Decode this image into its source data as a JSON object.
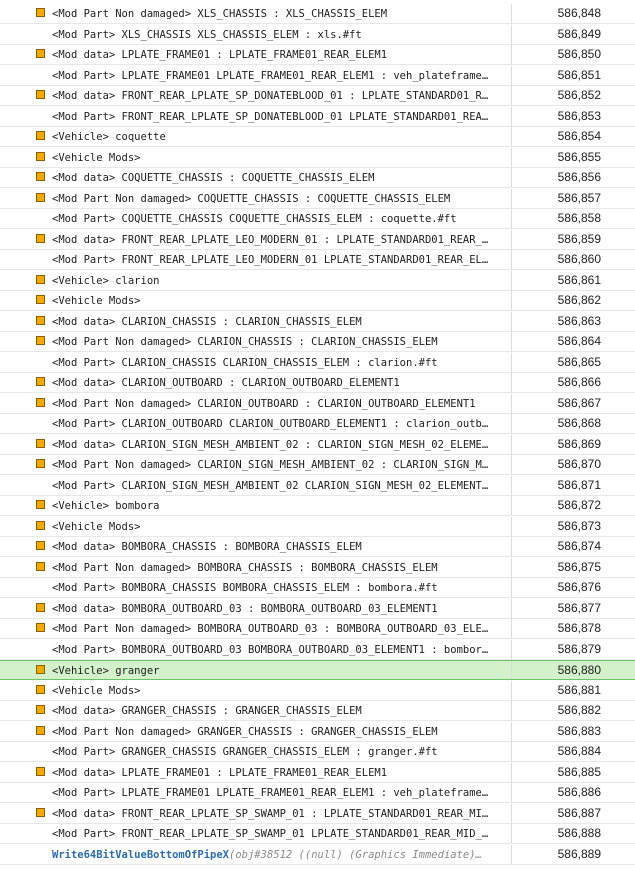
{
  "colors": {
    "marker": "#f2a900",
    "highlight_row": "#d3f2cc",
    "function_text": "#2b6cb0"
  },
  "rows": [
    {
      "marker": true,
      "label": "<Mod Part Non damaged> XLS_CHASSIS : XLS_CHASSIS_ELEM",
      "id": "586,848"
    },
    {
      "marker": false,
      "label": "<Mod Part> XLS_CHASSIS XLS_CHASSIS_ELEM : xls.#ft",
      "id": "586,849"
    },
    {
      "marker": true,
      "label": "<Mod data> LPLATE_FRAME01 : LPLATE_FRAME01_REAR_ELEM1",
      "id": "586,850"
    },
    {
      "marker": false,
      "label": "<Mod Part> LPLATE_FRAME01 LPLATE_FRAME01_REAR_ELEM1 : veh_plateframe…",
      "id": "586,851"
    },
    {
      "marker": true,
      "label": "<Mod data> FRONT_REAR_LPLATE_SP_DONATEBLOOD_01 : LPLATE_STANDARD01_R…",
      "id": "586,852"
    },
    {
      "marker": false,
      "label": "<Mod Part> FRONT_REAR_LPLATE_SP_DONATEBLOOD_01 LPLATE_STANDARD01_REA…",
      "id": "586,853"
    },
    {
      "marker": true,
      "label": "<Vehicle> coquette",
      "id": "586,854"
    },
    {
      "marker": true,
      "label": "<Vehicle Mods>",
      "id": "586,855"
    },
    {
      "marker": true,
      "label": "<Mod data> COQUETTE_CHASSIS : COQUETTE_CHASSIS_ELEM",
      "id": "586,856"
    },
    {
      "marker": true,
      "label": "<Mod Part Non damaged> COQUETTE_CHASSIS : COQUETTE_CHASSIS_ELEM",
      "id": "586,857"
    },
    {
      "marker": false,
      "label": "<Mod Part> COQUETTE_CHASSIS COQUETTE_CHASSIS_ELEM : coquette.#ft",
      "id": "586,858"
    },
    {
      "marker": true,
      "label": "<Mod data> FRONT_REAR_LPLATE_LEO_MODERN_01 : LPLATE_STANDARD01_REAR_…",
      "id": "586,859"
    },
    {
      "marker": false,
      "label": "<Mod Part> FRONT_REAR_LPLATE_LEO_MODERN_01 LPLATE_STANDARD01_REAR_EL…",
      "id": "586,860"
    },
    {
      "marker": true,
      "label": "<Vehicle> clarion",
      "id": "586,861"
    },
    {
      "marker": true,
      "label": "<Vehicle Mods>",
      "id": "586,862"
    },
    {
      "marker": true,
      "label": "<Mod data> CLARION_CHASSIS : CLARION_CHASSIS_ELEM",
      "id": "586,863"
    },
    {
      "marker": true,
      "label": "<Mod Part Non damaged> CLARION_CHASSIS : CLARION_CHASSIS_ELEM",
      "id": "586,864"
    },
    {
      "marker": false,
      "label": "<Mod Part> CLARION_CHASSIS CLARION_CHASSIS_ELEM : clarion.#ft",
      "id": "586,865"
    },
    {
      "marker": true,
      "label": "<Mod data> CLARION_OUTBOARD : CLARION_OUTBOARD_ELEMENT1",
      "id": "586,866"
    },
    {
      "marker": true,
      "label": "<Mod Part Non damaged> CLARION_OUTBOARD : CLARION_OUTBOARD_ELEMENT1",
      "id": "586,867"
    },
    {
      "marker": false,
      "label": "<Mod Part> CLARION_OUTBOARD CLARION_OUTBOARD_ELEMENT1 : clarion_outb…",
      "id": "586,868"
    },
    {
      "marker": true,
      "label": "<Mod data> CLARION_SIGN_MESH_AMBIENT_02 : CLARION_SIGN_MESH_02_ELEME…",
      "id": "586,869"
    },
    {
      "marker": true,
      "label": "<Mod Part Non damaged> CLARION_SIGN_MESH_AMBIENT_02 : CLARION_SIGN_M…",
      "id": "586,870"
    },
    {
      "marker": false,
      "label": "<Mod Part> CLARION_SIGN_MESH_AMBIENT_02 CLARION_SIGN_MESH_02_ELEMENT…",
      "id": "586,871"
    },
    {
      "marker": true,
      "label": "<Vehicle> bombora",
      "id": "586,872"
    },
    {
      "marker": true,
      "label": "<Vehicle Mods>",
      "id": "586,873"
    },
    {
      "marker": true,
      "label": "<Mod data> BOMBORA_CHASSIS : BOMBORA_CHASSIS_ELEM",
      "id": "586,874"
    },
    {
      "marker": true,
      "label": "<Mod Part Non damaged> BOMBORA_CHASSIS : BOMBORA_CHASSIS_ELEM",
      "id": "586,875"
    },
    {
      "marker": false,
      "label": "<Mod Part> BOMBORA_CHASSIS BOMBORA_CHASSIS_ELEM : bombora.#ft",
      "id": "586,876"
    },
    {
      "marker": true,
      "label": "<Mod data> BOMBORA_OUTBOARD_03 : BOMBORA_OUTBOARD_03_ELEMENT1",
      "id": "586,877"
    },
    {
      "marker": true,
      "label": "<Mod Part Non damaged> BOMBORA_OUTBOARD_03 : BOMBORA_OUTBOARD_03_ELE…",
      "id": "586,878"
    },
    {
      "marker": false,
      "label": "<Mod Part> BOMBORA_OUTBOARD_03 BOMBORA_OUTBOARD_03_ELEMENT1 : bombor…",
      "id": "586,879"
    },
    {
      "marker": true,
      "label": "<Vehicle> granger",
      "id": "586,880",
      "highlight": true
    },
    {
      "marker": true,
      "label": "<Vehicle Mods>",
      "id": "586,881"
    },
    {
      "marker": true,
      "label": "<Mod data> GRANGER_CHASSIS : GRANGER_CHASSIS_ELEM",
      "id": "586,882"
    },
    {
      "marker": true,
      "label": "<Mod Part Non damaged> GRANGER_CHASSIS : GRANGER_CHASSIS_ELEM",
      "id": "586,883"
    },
    {
      "marker": false,
      "label": "<Mod Part> GRANGER_CHASSIS GRANGER_CHASSIS_ELEM : granger.#ft",
      "id": "586,884"
    },
    {
      "marker": true,
      "label": "<Mod data> LPLATE_FRAME01 : LPLATE_FRAME01_REAR_ELEM1",
      "id": "586,885"
    },
    {
      "marker": false,
      "label": "<Mod Part> LPLATE_FRAME01 LPLATE_FRAME01_REAR_ELEM1 : veh_plateframe…",
      "id": "586,886"
    },
    {
      "marker": true,
      "label": "<Mod data> FRONT_REAR_LPLATE_SP_SWAMP_01 : LPLATE_STANDARD01_REAR_MI…",
      "id": "586,887"
    },
    {
      "marker": false,
      "label": "<Mod Part> FRONT_REAR_LPLATE_SP_SWAMP_01 LPLATE_STANDARD01_REAR_MID_…",
      "id": "586,888"
    },
    {
      "marker": false,
      "fn": "Write64BitValueBottomOfPipeX",
      "args": "(obj#38512 ((null) (Graphics Immediate)…",
      "id": "586,889"
    }
  ]
}
